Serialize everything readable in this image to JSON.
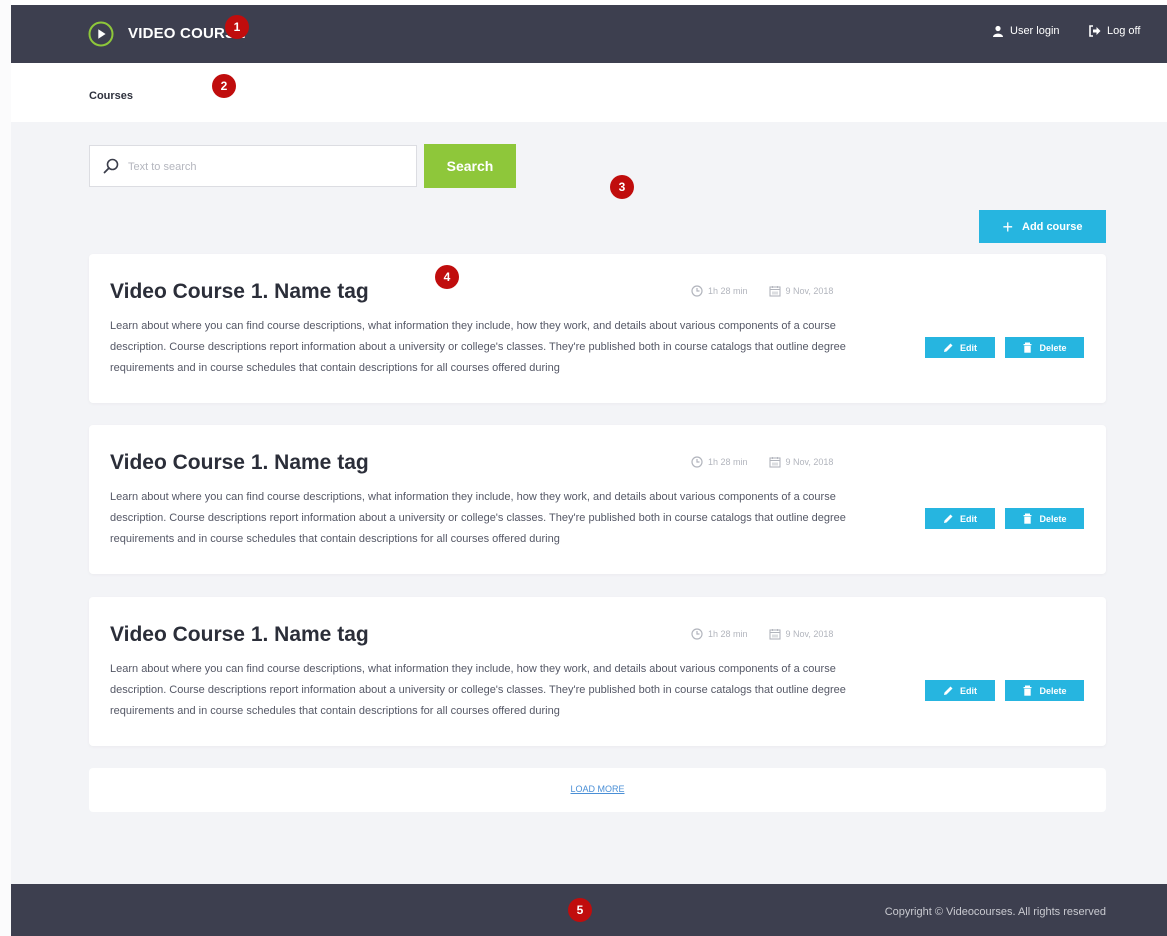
{
  "header": {
    "logo_text": "VIDEO COURSE",
    "user_login": "User login",
    "log_off": "Log off"
  },
  "breadcrumb": {
    "label": "Courses"
  },
  "search": {
    "placeholder": "Text to search",
    "value": "",
    "button": "Search"
  },
  "add_course": {
    "label": "Add course"
  },
  "courses": [
    {
      "title": "Video Course 1. Name tag",
      "duration": "1h 28 min",
      "date": "9 Nov, 2018",
      "description": "Learn about where you can find course descriptions, what information they include, how they work, and details about various components of a course description. Course descriptions report information about a university or college's classes. They're published both in course catalogs that outline degree requirements and in course schedules that contain descriptions for all courses offered during",
      "edit": "Edit",
      "delete": "Delete"
    },
    {
      "title": "Video Course 1. Name tag",
      "duration": "1h 28 min",
      "date": "9 Nov, 2018",
      "description": "Learn about where you can find course descriptions, what information they include, how they work, and details about various components of a course description. Course descriptions report information about a university or college's classes. They're published both in course catalogs that outline degree requirements and in course schedules that contain descriptions for all courses offered during",
      "edit": "Edit",
      "delete": "Delete"
    },
    {
      "title": "Video Course 1. Name tag",
      "duration": "1h 28 min",
      "date": "9 Nov, 2018",
      "description": "Learn about where you can find course descriptions, what information they include, how they work, and details about various components of a course description. Course descriptions report information about a university or college's classes. They're published both in course catalogs that outline degree requirements and in course schedules that contain descriptions for all courses offered during",
      "edit": "Edit",
      "delete": "Delete"
    }
  ],
  "load_more": "LOAD MORE",
  "footer": {
    "copyright": "Copyright © Videocourses. All rights reserved"
  },
  "annotations": [
    "1",
    "2",
    "3",
    "4",
    "5"
  ],
  "colors": {
    "header_bg": "#3d3f4f",
    "logo_accent": "#8ec73a",
    "search_button": "#8ec73a",
    "primary_button": "#26b5e0",
    "badge": "#c00d0d",
    "page_bg": "#f3f4f7"
  },
  "icons": {
    "logo": "play-circle-icon",
    "user": "user-icon",
    "logoff": "sign-out-icon",
    "search": "search-icon",
    "add": "plus-icon",
    "duration": "clock-icon",
    "date": "calendar-icon",
    "edit": "pencil-icon",
    "delete": "trash-icon"
  }
}
